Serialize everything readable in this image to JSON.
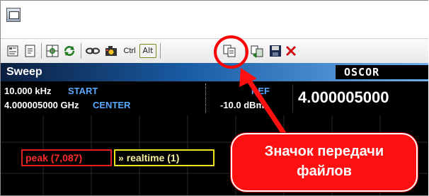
{
  "toolbar": {
    "ctrl_label": "Ctrl",
    "alt_label": "Alt",
    "icons": [
      "properties-icon",
      "document-icon",
      "grid-icon",
      "refresh-icon",
      "link-icon",
      "camera-icon",
      "ctrl-key",
      "alt-key",
      "file-transfer-icon",
      "export-icon",
      "save-icon",
      "close-icon"
    ]
  },
  "sweep": {
    "label": "Sweep",
    "brand": "OSCOR"
  },
  "info": {
    "start_value": "10.000 kHz",
    "start_label": "START",
    "center_value": "4.000005000 GHz",
    "center_label": "CENTER",
    "ref_label": "REF",
    "ref_value": "-10.0 dBm",
    "big_value": "4.000005000"
  },
  "traces": {
    "peak_label": "peak (7,087)",
    "realtime_label": "realtime (1)",
    "realtime_marker": "»"
  },
  "callout": {
    "line1": "Значок передачи",
    "line2": "файлов"
  },
  "colors": {
    "annotation_red": "#ff1010",
    "peak_red": "#e02020",
    "realtime_yellow": "#f0e020",
    "start_blue": "#5aa8ff"
  }
}
